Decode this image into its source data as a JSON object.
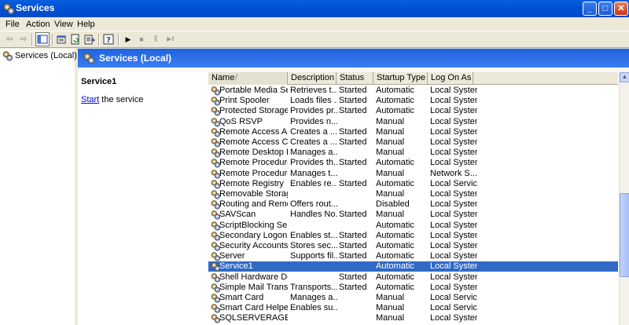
{
  "window": {
    "title": "Services",
    "buttons": {
      "minimize": "_",
      "maximize": "□",
      "close": "✕"
    }
  },
  "menu": [
    "File",
    "Action",
    "View",
    "Help"
  ],
  "toolbar": {
    "back_glyph": "⇦",
    "forward_glyph": "⇨",
    "play_glyph": "▶",
    "stop_glyph": "■",
    "pause_glyph": "‖",
    "restart_glyph": "▶‖"
  },
  "tree": {
    "root_label": "Services (Local)"
  },
  "header": {
    "title": "Services (Local)"
  },
  "description": {
    "service_name": "Service1",
    "start_link": "Start",
    "start_suffix": " the service"
  },
  "columns": {
    "name": "Name",
    "sort_indicator": "/",
    "description": "Description",
    "status": "Status",
    "startup_type": "Startup Type",
    "logon_as": "Log On As"
  },
  "services": [
    {
      "name": "Portable Media Seri...",
      "description": "Retrieves t...",
      "status": "Started",
      "startup": "Automatic",
      "logon": "Local System"
    },
    {
      "name": "Print Spooler",
      "description": "Loads files ...",
      "status": "Started",
      "startup": "Automatic",
      "logon": "Local System"
    },
    {
      "name": "Protected Storage",
      "description": "Provides pr...",
      "status": "Started",
      "startup": "Automatic",
      "logon": "Local System"
    },
    {
      "name": "QoS RSVP",
      "description": "Provides n...",
      "status": "",
      "startup": "Manual",
      "logon": "Local System"
    },
    {
      "name": "Remote Access Aut...",
      "description": "Creates a ...",
      "status": "Started",
      "startup": "Manual",
      "logon": "Local System"
    },
    {
      "name": "Remote Access Con...",
      "description": "Creates a ...",
      "status": "Started",
      "startup": "Manual",
      "logon": "Local System"
    },
    {
      "name": "Remote Desktop He...",
      "description": "Manages a...",
      "status": "",
      "startup": "Manual",
      "logon": "Local System"
    },
    {
      "name": "Remote Procedure ...",
      "description": "Provides th...",
      "status": "Started",
      "startup": "Automatic",
      "logon": "Local System"
    },
    {
      "name": "Remote Procedure ...",
      "description": "Manages t...",
      "status": "",
      "startup": "Manual",
      "logon": "Network S..."
    },
    {
      "name": "Remote Registry",
      "description": "Enables re...",
      "status": "Started",
      "startup": "Automatic",
      "logon": "Local Service"
    },
    {
      "name": "Removable Storage",
      "description": "",
      "status": "",
      "startup": "Manual",
      "logon": "Local System"
    },
    {
      "name": "Routing and Remot...",
      "description": "Offers rout...",
      "status": "",
      "startup": "Disabled",
      "logon": "Local System"
    },
    {
      "name": "SAVScan",
      "description": "Handles No...",
      "status": "Started",
      "startup": "Manual",
      "logon": "Local System"
    },
    {
      "name": "ScriptBlocking Service",
      "description": "",
      "status": "",
      "startup": "Automatic",
      "logon": "Local System"
    },
    {
      "name": "Secondary Logon",
      "description": "Enables st...",
      "status": "Started",
      "startup": "Automatic",
      "logon": "Local System"
    },
    {
      "name": "Security Accounts ...",
      "description": "Stores sec...",
      "status": "Started",
      "startup": "Automatic",
      "logon": "Local System"
    },
    {
      "name": "Server",
      "description": "Supports fil...",
      "status": "Started",
      "startup": "Automatic",
      "logon": "Local System"
    },
    {
      "name": "Service1",
      "description": "",
      "status": "",
      "startup": "Automatic",
      "logon": "Local System",
      "selected": true
    },
    {
      "name": "Shell Hardware Det...",
      "description": "",
      "status": "Started",
      "startup": "Automatic",
      "logon": "Local System"
    },
    {
      "name": "Simple Mail Transfer...",
      "description": "Transports...",
      "status": "Started",
      "startup": "Automatic",
      "logon": "Local System"
    },
    {
      "name": "Smart Card",
      "description": "Manages a...",
      "status": "",
      "startup": "Manual",
      "logon": "Local Service"
    },
    {
      "name": "Smart Card Helper",
      "description": "Enables su...",
      "status": "",
      "startup": "Manual",
      "logon": "Local Service"
    },
    {
      "name": "SQLSERVERAGENT",
      "description": "",
      "status": "",
      "startup": "Manual",
      "logon": "Local System"
    }
  ],
  "scrollbar": {
    "up_glyph": "▲",
    "position_fraction": 0.7
  },
  "colors": {
    "title_bar": "#0052d6",
    "selection": "#316ac5",
    "link": "#0000ee"
  }
}
